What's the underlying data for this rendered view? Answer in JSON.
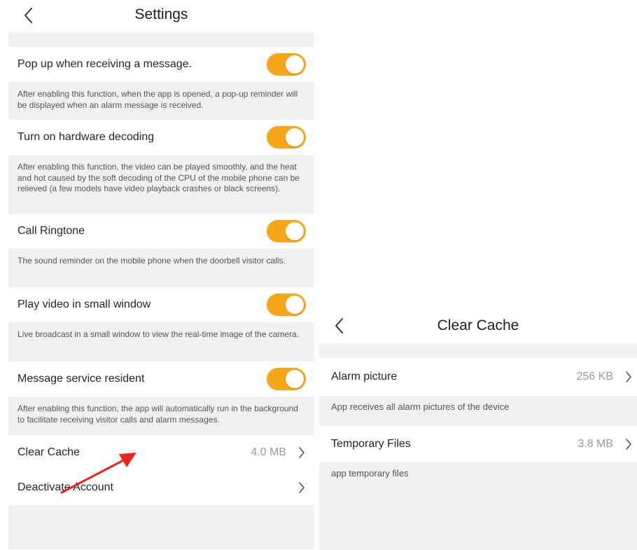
{
  "settings": {
    "title": "Settings",
    "toggles": [
      {
        "label": "Pop up when receiving a message.",
        "on": true,
        "desc": "After enabling this function, when the app is opened, a pop-up reminder will be displayed when an alarm message is received."
      },
      {
        "label": "Turn on hardware decoding",
        "on": true,
        "desc": "After enabling this function, the video can be played smoothly, and the heat and hot caused by the soft decoding of the CPU of the mobile phone can be relieved (a few models have video playback crashes or black screens)."
      },
      {
        "label": "Call Ringtone",
        "on": true,
        "desc": "The sound reminder on the mobile phone when the doorbell visitor calls."
      },
      {
        "label": "Play video in small window",
        "on": true,
        "desc": "Live broadcast in a small window to view the real-time image of the camera."
      },
      {
        "label": "Message service resident",
        "on": true,
        "desc": "After enabling this function, the app will automatically run in the background to facilitate receiving visitor calls and alarm messages."
      }
    ],
    "clear_cache": {
      "label": "Clear Cache",
      "value": "4.0 MB"
    },
    "deactivate": {
      "label": "Deactivate Account"
    }
  },
  "clear_cache_screen": {
    "title": "Clear Cache",
    "items": [
      {
        "label": "Alarm picture",
        "value": "256 KB",
        "desc": "App receives all alarm pictures of the device"
      },
      {
        "label": "Temporary Files",
        "value": "3.8 MB",
        "desc": "app temporary files"
      }
    ]
  },
  "colors": {
    "accent": "#f6a719",
    "section_bg": "#f1f1f1",
    "annotation_arrow": "#e8261c"
  },
  "icons": {
    "back": "chevron-left-icon",
    "disclosure": "chevron-right-icon"
  }
}
